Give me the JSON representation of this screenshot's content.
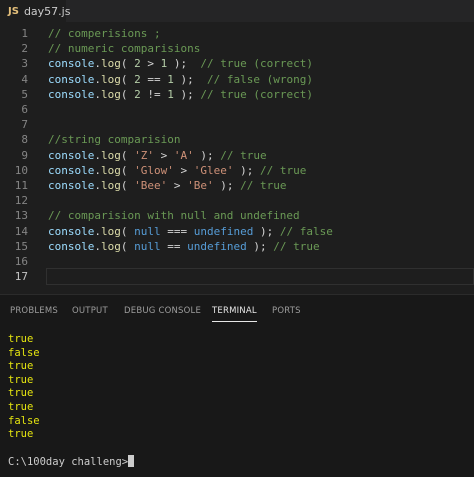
{
  "tab": {
    "icon_label": "JS",
    "filename": "day57.js"
  },
  "editor": {
    "lines": [
      {
        "no": "1",
        "tokens": [
          [
            "c-comment",
            "// comperisions ;"
          ]
        ]
      },
      {
        "no": "2",
        "tokens": [
          [
            "c-comment",
            "// numeric comparisions"
          ]
        ]
      },
      {
        "no": "3",
        "tokens": [
          [
            "c-obj",
            "console"
          ],
          [
            "c-punc",
            "."
          ],
          [
            "c-fn",
            "log"
          ],
          [
            "c-punc",
            "( "
          ],
          [
            "c-num",
            "2"
          ],
          [
            "c-punc",
            " > "
          ],
          [
            "c-num",
            "1"
          ],
          [
            "c-punc",
            " );  "
          ],
          [
            "c-comment",
            "// true (correct)"
          ]
        ]
      },
      {
        "no": "4",
        "tokens": [
          [
            "c-obj",
            "console"
          ],
          [
            "c-punc",
            "."
          ],
          [
            "c-fn",
            "log"
          ],
          [
            "c-punc",
            "( "
          ],
          [
            "c-num",
            "2"
          ],
          [
            "c-punc",
            " == "
          ],
          [
            "c-num",
            "1"
          ],
          [
            "c-punc",
            " );  "
          ],
          [
            "c-comment",
            "// false (wrong)"
          ]
        ]
      },
      {
        "no": "5",
        "tokens": [
          [
            "c-obj",
            "console"
          ],
          [
            "c-punc",
            "."
          ],
          [
            "c-fn",
            "log"
          ],
          [
            "c-punc",
            "( "
          ],
          [
            "c-num",
            "2"
          ],
          [
            "c-punc",
            " != "
          ],
          [
            "c-num",
            "1"
          ],
          [
            "c-punc",
            " ); "
          ],
          [
            "c-comment",
            "// true (correct)"
          ]
        ]
      },
      {
        "no": "6",
        "tokens": []
      },
      {
        "no": "7",
        "tokens": []
      },
      {
        "no": "8",
        "tokens": [
          [
            "c-comment",
            "//string comparision"
          ]
        ]
      },
      {
        "no": "9",
        "tokens": [
          [
            "c-obj",
            "console"
          ],
          [
            "c-punc",
            "."
          ],
          [
            "c-fn",
            "log"
          ],
          [
            "c-punc",
            "( "
          ],
          [
            "c-str",
            "'Z'"
          ],
          [
            "c-punc",
            " > "
          ],
          [
            "c-str",
            "'A'"
          ],
          [
            "c-punc",
            " ); "
          ],
          [
            "c-comment",
            "// true"
          ]
        ]
      },
      {
        "no": "10",
        "tokens": [
          [
            "c-obj",
            "console"
          ],
          [
            "c-punc",
            "."
          ],
          [
            "c-fn",
            "log"
          ],
          [
            "c-punc",
            "( "
          ],
          [
            "c-str",
            "'Glow'"
          ],
          [
            "c-punc",
            " > "
          ],
          [
            "c-str",
            "'Glee'"
          ],
          [
            "c-punc",
            " ); "
          ],
          [
            "c-comment",
            "// true"
          ]
        ]
      },
      {
        "no": "11",
        "tokens": [
          [
            "c-obj",
            "console"
          ],
          [
            "c-punc",
            "."
          ],
          [
            "c-fn",
            "log"
          ],
          [
            "c-punc",
            "( "
          ],
          [
            "c-str",
            "'Bee'"
          ],
          [
            "c-punc",
            " > "
          ],
          [
            "c-str",
            "'Be'"
          ],
          [
            "c-punc",
            " ); "
          ],
          [
            "c-comment",
            "// true"
          ]
        ]
      },
      {
        "no": "12",
        "tokens": []
      },
      {
        "no": "13",
        "tokens": [
          [
            "c-comment",
            "// comparision with null and undefined"
          ]
        ]
      },
      {
        "no": "14",
        "tokens": [
          [
            "c-obj",
            "console"
          ],
          [
            "c-punc",
            "."
          ],
          [
            "c-fn",
            "log"
          ],
          [
            "c-punc",
            "( "
          ],
          [
            "c-kw",
            "null"
          ],
          [
            "c-punc",
            " === "
          ],
          [
            "c-kw",
            "undefined"
          ],
          [
            "c-punc",
            " ); "
          ],
          [
            "c-comment",
            "// false"
          ]
        ]
      },
      {
        "no": "15",
        "tokens": [
          [
            "c-obj",
            "console"
          ],
          [
            "c-punc",
            "."
          ],
          [
            "c-fn",
            "log"
          ],
          [
            "c-punc",
            "( "
          ],
          [
            "c-kw",
            "null"
          ],
          [
            "c-punc",
            " == "
          ],
          [
            "c-kw",
            "undefined"
          ],
          [
            "c-punc",
            " ); "
          ],
          [
            "c-comment",
            "// true"
          ]
        ]
      },
      {
        "no": "16",
        "tokens": []
      },
      {
        "no": "17",
        "tokens": [],
        "active": true
      }
    ]
  },
  "panel": {
    "tabs": [
      {
        "label": "PROBLEMS",
        "active": false
      },
      {
        "label": "OUTPUT",
        "active": false
      },
      {
        "label": "DEBUG CONSOLE",
        "active": false
      },
      {
        "label": "TERMINAL",
        "active": true
      },
      {
        "label": "PORTS",
        "active": false
      }
    ],
    "terminal_output": [
      "true",
      "false",
      "true",
      "true",
      "true",
      "true",
      "false",
      "true"
    ],
    "prompt": "C:\\100day challeng>"
  },
  "colors": {
    "editor_bg": "#1e1e1e",
    "comment": "#6a9955",
    "identifier": "#9cdcfe",
    "function": "#dcdcaa",
    "number": "#b5cea8",
    "string": "#ce9178",
    "keyword": "#569cd6",
    "terminal_output": "#e5e510"
  }
}
